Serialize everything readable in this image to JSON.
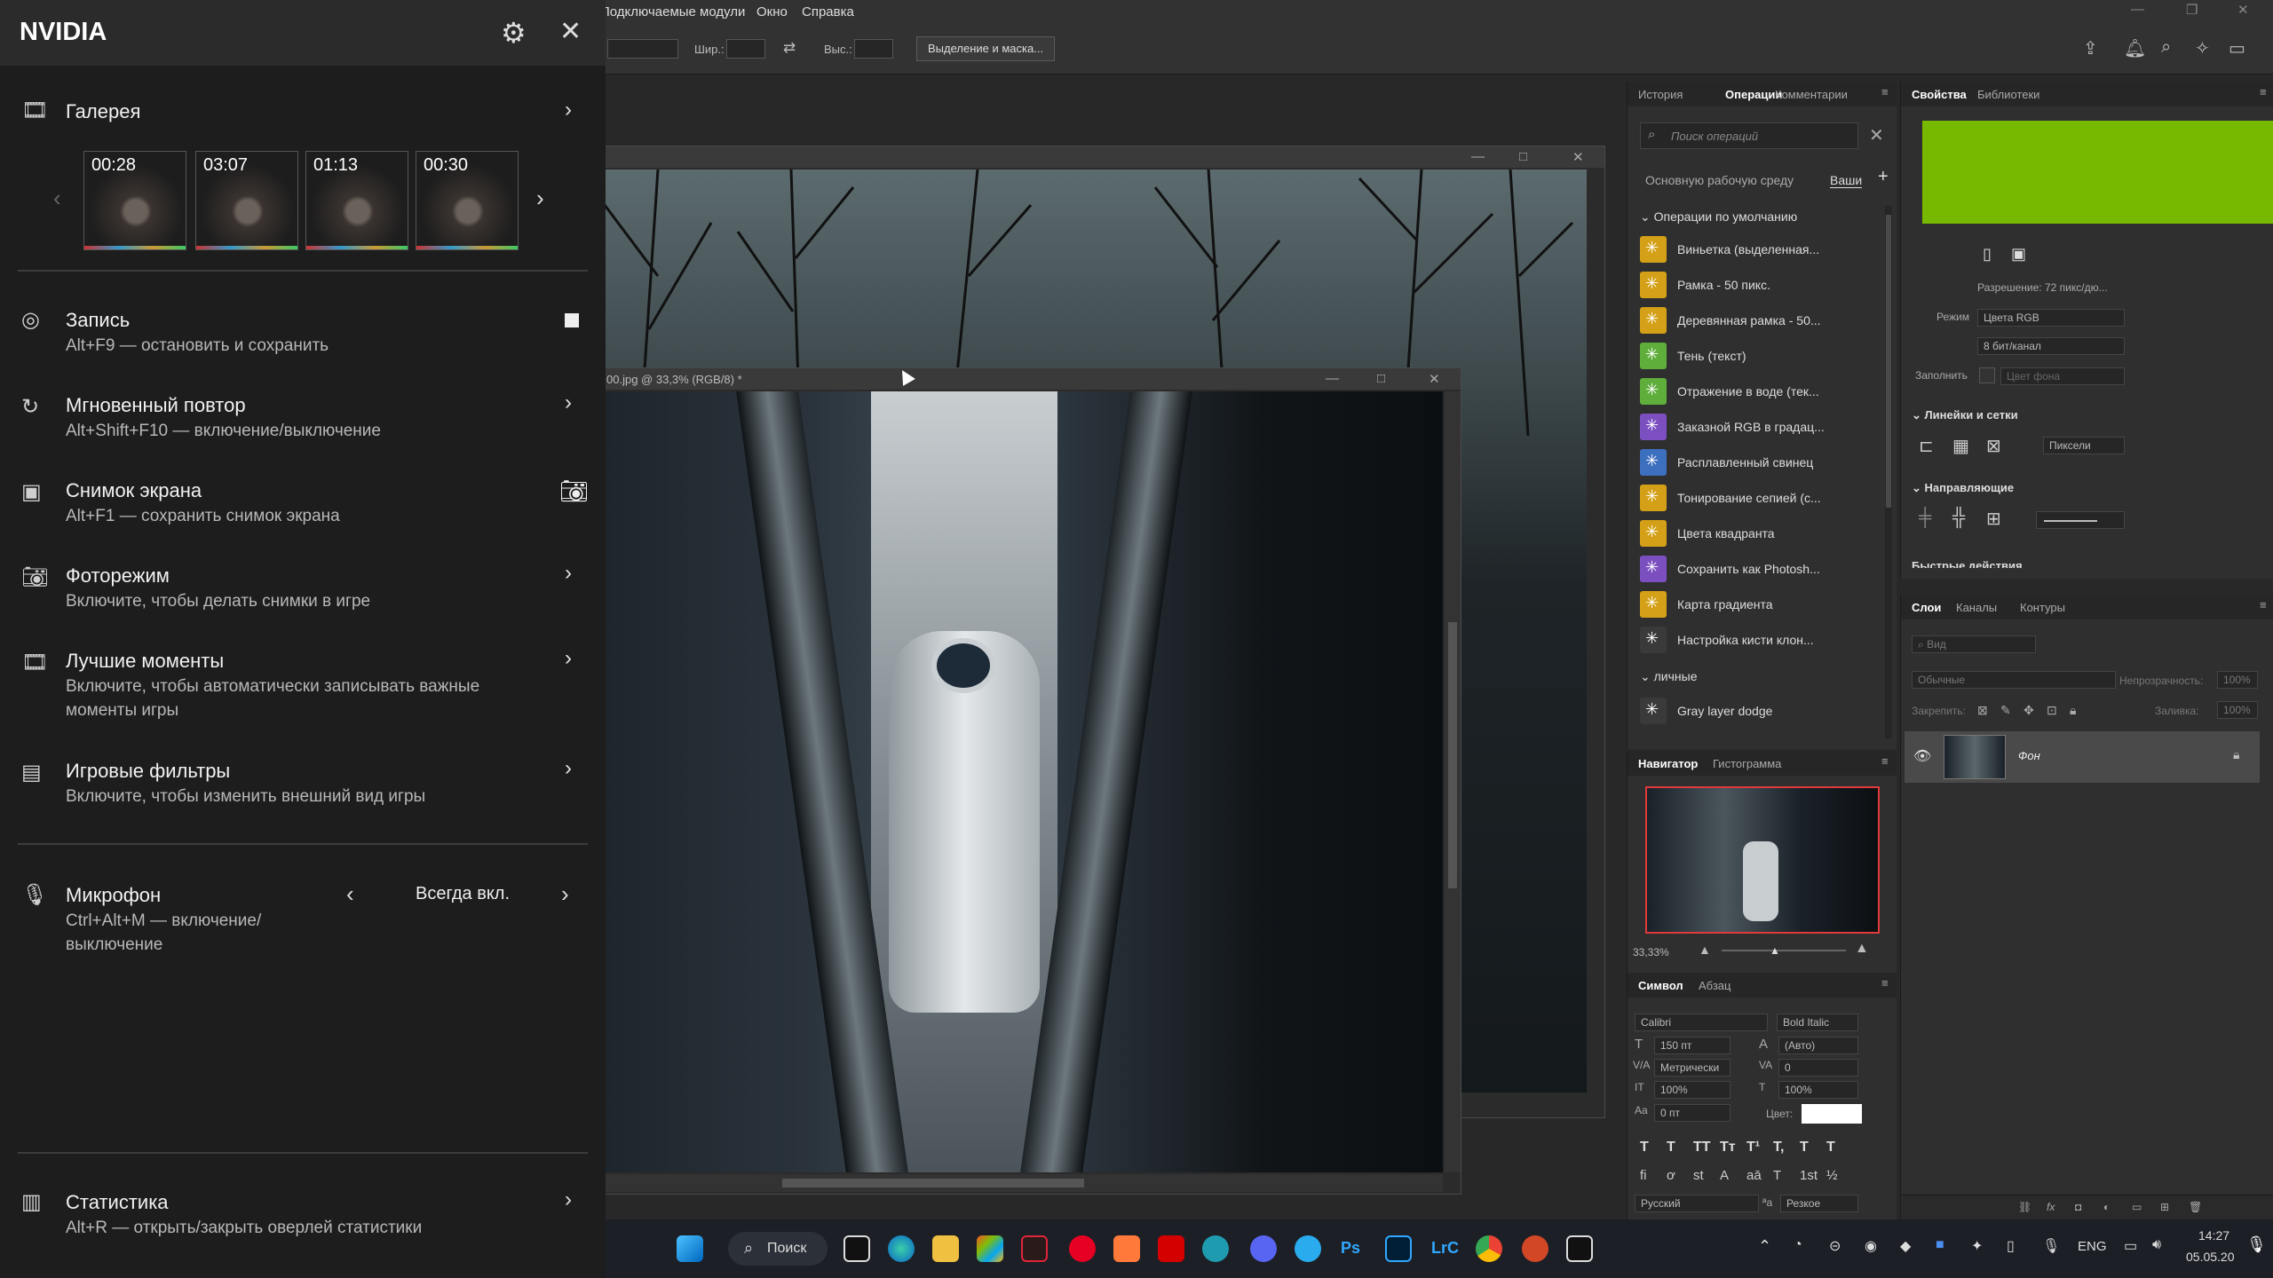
{
  "photoshop": {
    "menu": [
      "Подключаемые модули",
      "Окно",
      "Справка"
    ],
    "options": {
      "width_label": "Шир.:",
      "height_label": "Выс.:",
      "select_mask_button": "Выделение и маска..."
    },
    "doc_back_title": "",
    "doc_front_title": "00.jpg @ 33,3% (RGB/8) *",
    "ops_panel": {
      "tabs": [
        "История",
        "Операции",
        "Комментарии"
      ],
      "search_placeholder": "Поиск операций",
      "workspace_label": "Основную рабочую среду",
      "workspace_tab": "Ваши",
      "default_group": "Операции по умолчанию",
      "items": [
        {
          "label": "Виньетка (выделенная...",
          "color": "#d4a017"
        },
        {
          "label": "Рамка - 50 пикс.",
          "color": "#d4a017"
        },
        {
          "label": "Деревянная рамка - 50...",
          "color": "#d4a017"
        },
        {
          "label": "Тень (текст)",
          "color": "#5fae3c"
        },
        {
          "label": "Отражение в воде (тек...",
          "color": "#5fae3c"
        },
        {
          "label": "Заказной RGB в градац...",
          "color": "#7b4fc0"
        },
        {
          "label": "Расплавленный свинец",
          "color": "#3d6fbf"
        },
        {
          "label": "Тонирование сепией (с...",
          "color": "#d4a017"
        },
        {
          "label": "Цвета квадранта",
          "color": "#d4a017"
        },
        {
          "label": "Сохранить как Photosh...",
          "color": "#7b4fc0"
        },
        {
          "label": "Карта градиента",
          "color": "#d4a017"
        },
        {
          "label": "Настройка кисти клон...",
          "color": "#3a3a3a"
        }
      ],
      "personal_group": "личные",
      "personal_items": [
        {
          "label": "Gray layer dodge",
          "color": "#3a3a3a"
        }
      ]
    },
    "navigator": {
      "tabs": [
        "Навигатор",
        "Гистограмма"
      ],
      "zoom": "33,33%"
    },
    "character": {
      "tabs": [
        "Символ",
        "Абзац"
      ],
      "font": "Calibri",
      "style": "Bold Italic",
      "size": "150 пт",
      "leading": "(Авто)",
      "kerning": "Метрически",
      "tracking": "0",
      "vscale": "100%",
      "hscale": "100%",
      "baseline": "0 пт",
      "color_label": "Цвет:",
      "glyph_buttons": [
        "T",
        "T",
        "TT",
        "Tт",
        "T¹",
        "T,",
        "T",
        "T"
      ],
      "ligature_buttons": [
        "fi",
        "ơ",
        "st",
        "A",
        "aā",
        "T",
        "1st",
        "½"
      ],
      "language": "Русский",
      "aa_label": "ªa",
      "antialias": "Резкое"
    },
    "properties": {
      "tabs": [
        "Свойства",
        "Библиотеки"
      ],
      "swatch_color": "#76b900",
      "resolution": "Разрешение: 72 пикс/дю...",
      "mode_label": "Режим",
      "mode": "Цвета RGB",
      "depth": "8 бит/канал",
      "fill_label": "Заполнить",
      "fill": "Цвет фона",
      "rulers_section": "Линейки и сетки",
      "units": "Пиксели",
      "guides_section": "Направляющие",
      "quick_actions": "Быстрые действия"
    },
    "layers": {
      "tabs": [
        "Слои",
        "Каналы",
        "Контуры"
      ],
      "search_placeholder": "Вид",
      "blend": "Обычные",
      "opacity_label": "Непрозрачность:",
      "opacity": "100%",
      "lock_label": "Закрепить:",
      "fill_label": "Заливка:",
      "fill": "100%",
      "layer_name": "Фон"
    }
  },
  "nvidia": {
    "title": "NVIDIA",
    "gallery": {
      "label": "Галерея",
      "thumbs": [
        "00:28",
        "03:07",
        "01:13",
        "00:30"
      ]
    },
    "items": [
      {
        "title": "Запись",
        "sub": "Alt+F9 — остановить и сохранить"
      },
      {
        "title": "Мгновенный повтор",
        "sub": "Alt+Shift+F10 — включение/выключение"
      },
      {
        "title": "Снимок экрана",
        "sub": "Alt+F1 — сохранить снимок экрана"
      },
      {
        "title": "Фоторежим",
        "sub": "Включите, чтобы делать снимки в игре"
      },
      {
        "title": "Лучшие моменты",
        "sub": "Включите, чтобы автоматически записывать важные моменты игры"
      },
      {
        "title": "Игровые фильтры",
        "sub": "Включите, чтобы изменить внешний вид игры"
      }
    ],
    "mic": {
      "title": "Микрофон",
      "sub": "Ctrl+Alt+M — включение/ выключение",
      "value": "Всегда вкл."
    },
    "stats": {
      "title": "Статистика",
      "sub": "Alt+R — открыть/закрыть оверлей статистики"
    }
  },
  "taskbar": {
    "search_label": "Поиск",
    "lang": "ENG",
    "time": "14:27",
    "date": "05.05.20",
    "ps_label": "Ps",
    "lrc_label": "LrC"
  }
}
